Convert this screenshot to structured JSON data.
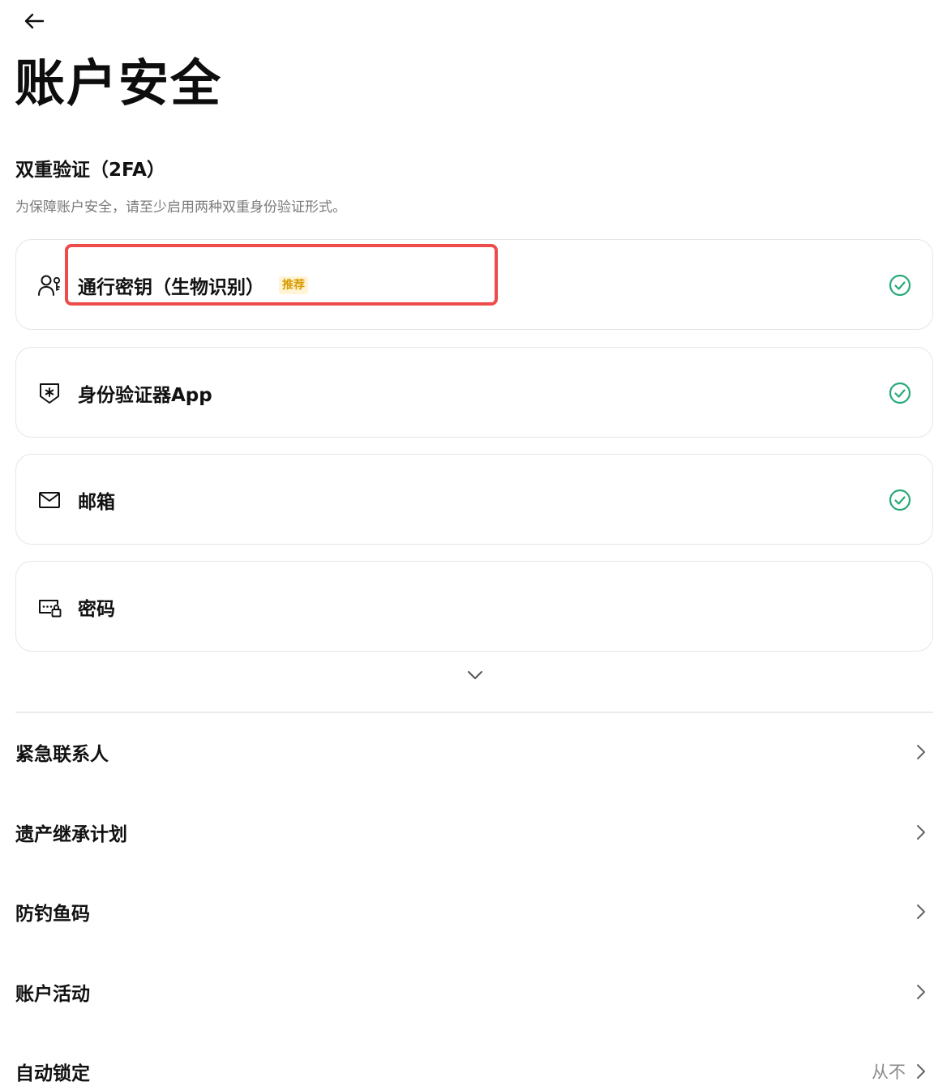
{
  "header": {
    "back_icon": "arrow-left-icon",
    "title": "账户安全"
  },
  "twofa": {
    "title": "双重验证（2FA）",
    "description": "为保障账户安全，请至少启用两种双重身份验证形式。",
    "methods": [
      {
        "label": "通行密钥（生物识别）",
        "badge": "推荐",
        "icon": "passkey-person-icon",
        "enabled": true
      },
      {
        "label": "身份验证器App",
        "icon": "authenticator-shield-icon",
        "enabled": true
      },
      {
        "label": "邮箱",
        "icon": "envelope-icon",
        "enabled": true
      },
      {
        "label": "密码",
        "icon": "password-lock-icon",
        "enabled": false
      }
    ],
    "expand_icon": "chevron-down-icon"
  },
  "settings": [
    {
      "label": "紧急联系人",
      "value": ""
    },
    {
      "label": "遗产继承计划",
      "value": ""
    },
    {
      "label": "防钓鱼码",
      "value": ""
    },
    {
      "label": "账户活动",
      "value": ""
    },
    {
      "label": "自动锁定",
      "value": "从不"
    }
  ],
  "colors": {
    "check_green": "#27a977",
    "badge_bg": "#fff4d6",
    "badge_text": "#d89b00",
    "highlight_red": "#ee4b4b",
    "card_border": "#e6e6e6"
  }
}
